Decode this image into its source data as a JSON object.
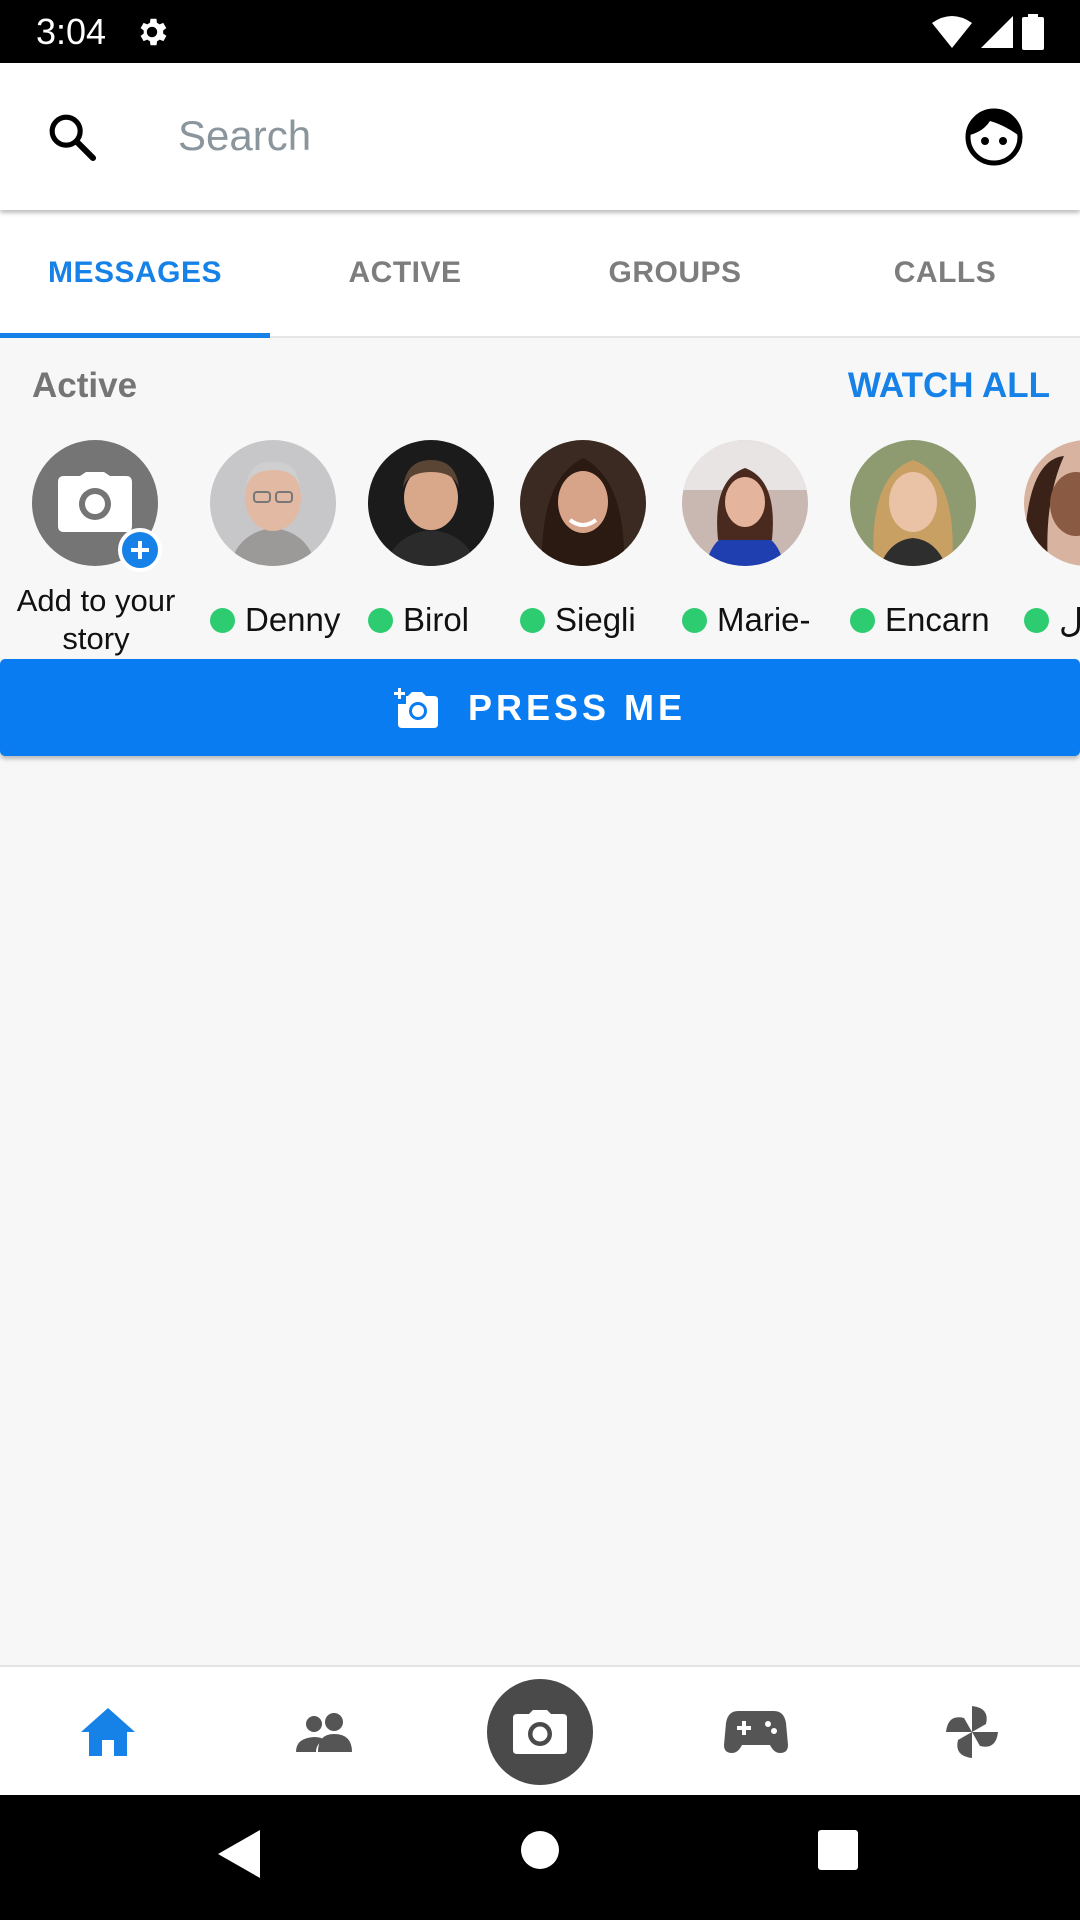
{
  "status_bar": {
    "time": "3:04"
  },
  "search": {
    "placeholder": "Search"
  },
  "tabs": [
    {
      "label": "MESSAGES",
      "active": true
    },
    {
      "label": "ACTIVE",
      "active": false
    },
    {
      "label": "GROUPS",
      "active": false
    },
    {
      "label": "CALLS",
      "active": false
    }
  ],
  "active_section": {
    "title": "Active",
    "watch_all": "WATCH ALL"
  },
  "add_story": {
    "label": "Add to your story"
  },
  "stories": [
    {
      "name": "Denny"
    },
    {
      "name": "Birol"
    },
    {
      "name": "Siegli"
    },
    {
      "name": "Marie-"
    },
    {
      "name": "Encarn"
    },
    {
      "name": "ل"
    }
  ],
  "press_button": {
    "label": "PRESS ME"
  },
  "bottom_nav": [
    "home-icon",
    "people-icon",
    "camera-icon",
    "gamepad-icon",
    "pinwheel-icon"
  ],
  "colors": {
    "accent": "#1682e8",
    "online": "#2ecc71",
    "button": "#0a7cf2"
  }
}
